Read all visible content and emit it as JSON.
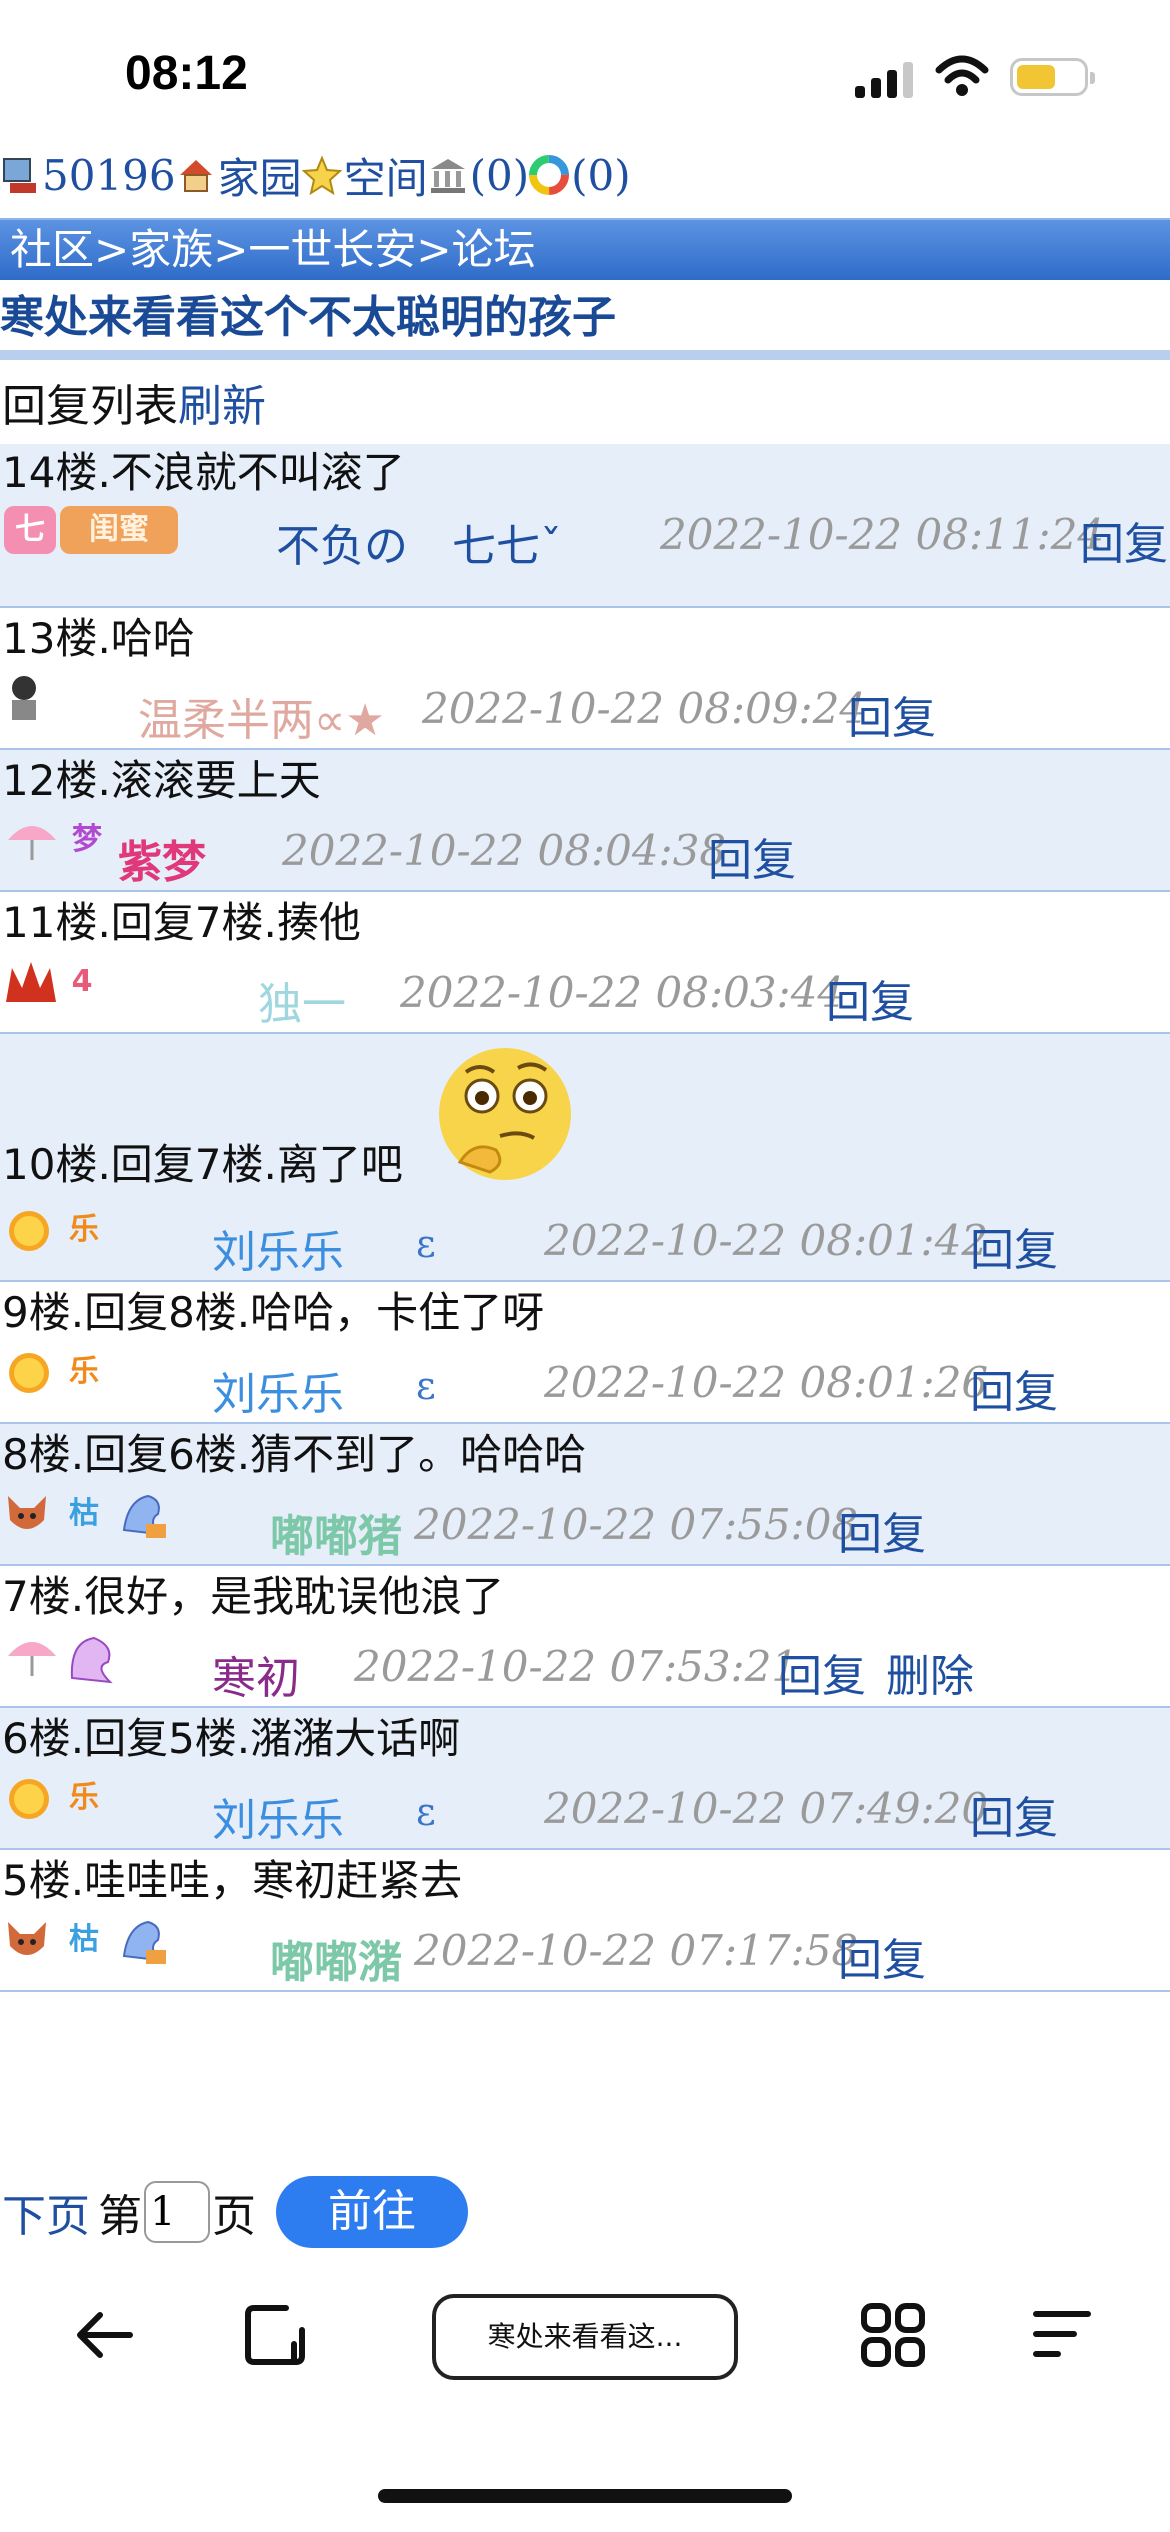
{
  "status": {
    "time": "08:12"
  },
  "header": {
    "user_id": "50196",
    "home": "家园",
    "space": "空间",
    "bank": "(0)",
    "msgs": "(0)"
  },
  "breadcrumb": "社区>家族>一世长安>论坛",
  "thread_title": "寒处来看看这个不太聪明的孩子",
  "list": {
    "label": "回复列表",
    "refresh": "刷新"
  },
  "posts": [
    {
      "content": "14楼.不浪就不叫滚了",
      "user": "不负の　七七ˇ",
      "user_color": "#1f4fa0",
      "badges": [
        "七",
        "闺蜜"
      ],
      "time": "2022-10-22 08:11:24",
      "reply": "回复"
    },
    {
      "content": "13楼.哈哈",
      "user": "温柔半两∝★",
      "user_color": "#e0a9a0",
      "badges": [],
      "time": "2022-10-22 08:09:24",
      "reply": "回复"
    },
    {
      "content": "12楼.滚滚要上天",
      "user": "紫梦",
      "user_color": "#e0387a",
      "badges": [
        "梦"
      ],
      "time": "2022-10-22 08:04:38",
      "reply": "回复"
    },
    {
      "content": "11楼.回复7楼.揍他",
      "user": "独一",
      "user_color": "#9fd6df",
      "badges": [
        "4"
      ],
      "time": "2022-10-22 08:03:44",
      "reply": "回复"
    },
    {
      "content": "10楼.回复7楼.离了吧",
      "user": "刘乐乐",
      "epsilon": "ε",
      "user_color": "#3c8ee0",
      "badges": [
        "乐"
      ],
      "time": "2022-10-22 08:01:42",
      "reply": "回复",
      "emoji": "thinking-face-emoji"
    },
    {
      "content": "9楼.回复8楼.哈哈，卡住了呀",
      "user": "刘乐乐",
      "epsilon": "ε",
      "user_color": "#3c8ee0",
      "badges": [
        "乐"
      ],
      "time": "2022-10-22 08:01:26",
      "reply": "回复"
    },
    {
      "content": "8楼.回复6楼.猜不到了。哈哈哈",
      "user": "嘟嘟猪",
      "user_color": "#7cc8a8",
      "badges": [
        "枯"
      ],
      "time": "2022-10-22 07:55:08",
      "reply": "回复"
    },
    {
      "content": "7楼.很好，是我耽误他浪了",
      "user": "寒初",
      "user_color": "#8a2a8a",
      "badges": [],
      "time": "2022-10-22 07:53:21",
      "reply": "回复",
      "delete": "删除"
    },
    {
      "content": "6楼.回复5楼.潴潴大话啊",
      "user": "刘乐乐",
      "epsilon": "ε",
      "user_color": "#3c8ee0",
      "badges": [
        "乐"
      ],
      "time": "2022-10-22 07:49:20",
      "reply": "回复"
    },
    {
      "content": "5楼.哇哇哇，寒初赶紧去",
      "user": "嘟嘟潴",
      "user_color": "#7cc8a8",
      "badges": [
        "枯"
      ],
      "time": "2022-10-22 07:17:58",
      "reply": "回复"
    }
  ],
  "pager": {
    "next": "下页",
    "page_prefix": "第",
    "page_value": "1",
    "page_suffix": "页",
    "go": "前往"
  },
  "browser": {
    "address": "寒处来看看这..."
  }
}
